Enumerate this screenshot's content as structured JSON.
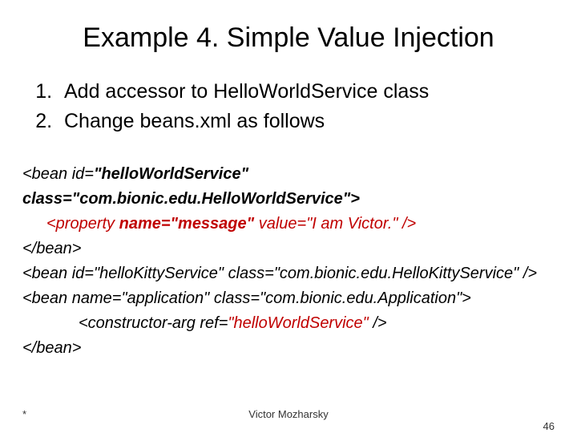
{
  "title": "Example 4. Simple Value Injection",
  "steps": [
    "Add accessor to HelloWorldService class",
    "Change beans.xml as follows"
  ],
  "code": {
    "line1": {
      "p1": "<bean id=",
      "p2": "\"helloWorldService\" class=\"com.bionic.edu.HelloWorldService\">"
    },
    "line2": {
      "p1": "<property ",
      "p2": "name=",
      "p3": "\"message\"",
      "p4": " value=\"I am Victor.\" />"
    },
    "line3": "</bean>",
    "line4": "<bean id=\"helloKittyService\" class=\"com.bionic.edu.HelloKittyService\" />",
    "line5": "<bean name=\"application\" class=\"com.bionic.edu.Application\">",
    "line6": {
      "p1": "<constructor-arg ref=",
      "p2": "\"helloWorldService\"",
      "p3": " />"
    },
    "line7": "</bean>"
  },
  "footer": {
    "mark": "*",
    "author": "Victor Mozharsky",
    "page": "46"
  }
}
